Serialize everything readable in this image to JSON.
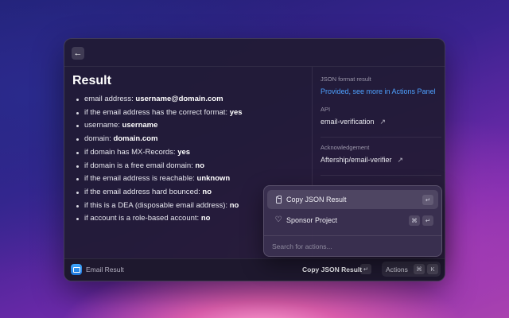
{
  "window": {
    "back_icon": "arrow-left-icon",
    "title": "Result",
    "results": [
      {
        "label": "email address: ",
        "value": "username@domain.com"
      },
      {
        "label": "if the email address has the correct format: ",
        "value": "yes"
      },
      {
        "label": "username: ",
        "value": "username"
      },
      {
        "label": "domain: ",
        "value": "domain.com"
      },
      {
        "label": "if domain has MX-Records: ",
        "value": "yes"
      },
      {
        "label": "if domain is a free email domain: ",
        "value": "no"
      },
      {
        "label": "if the email address is reachable: ",
        "value": "unknown"
      },
      {
        "label": "if the email address hard bounced: ",
        "value": "no"
      },
      {
        "label": "if this is a DEA (disposable email address): ",
        "value": "no"
      },
      {
        "label": "if account is a role-based account: ",
        "value": "no"
      }
    ]
  },
  "metadata": {
    "json_label": "JSON format result",
    "json_value": "Provided, see more in Actions Panel",
    "api_label": "API",
    "api_value": "email-verification",
    "ack_label": "Acknowledgement",
    "ack_value": "Aftership/email-verifier",
    "link_arrow": "↗"
  },
  "footer": {
    "app_title": "Email Result",
    "primary_action": "Copy JSON Result",
    "enter_key": "↵",
    "actions_label": "Actions",
    "cmd_key": "⌘",
    "k_key": "K"
  },
  "actions_panel": {
    "items": [
      {
        "label": "Copy JSON Result",
        "icon": "clipboard-icon",
        "keys": [
          "↵"
        ]
      },
      {
        "label": "Sponsor Project",
        "icon": "heart-icon",
        "keys": [
          "⌘",
          "↵"
        ]
      }
    ],
    "search_placeholder": "Search for actions..."
  },
  "colors": {
    "accent_link": "#4ea1ff",
    "app_icon": "#2a8cf0"
  }
}
